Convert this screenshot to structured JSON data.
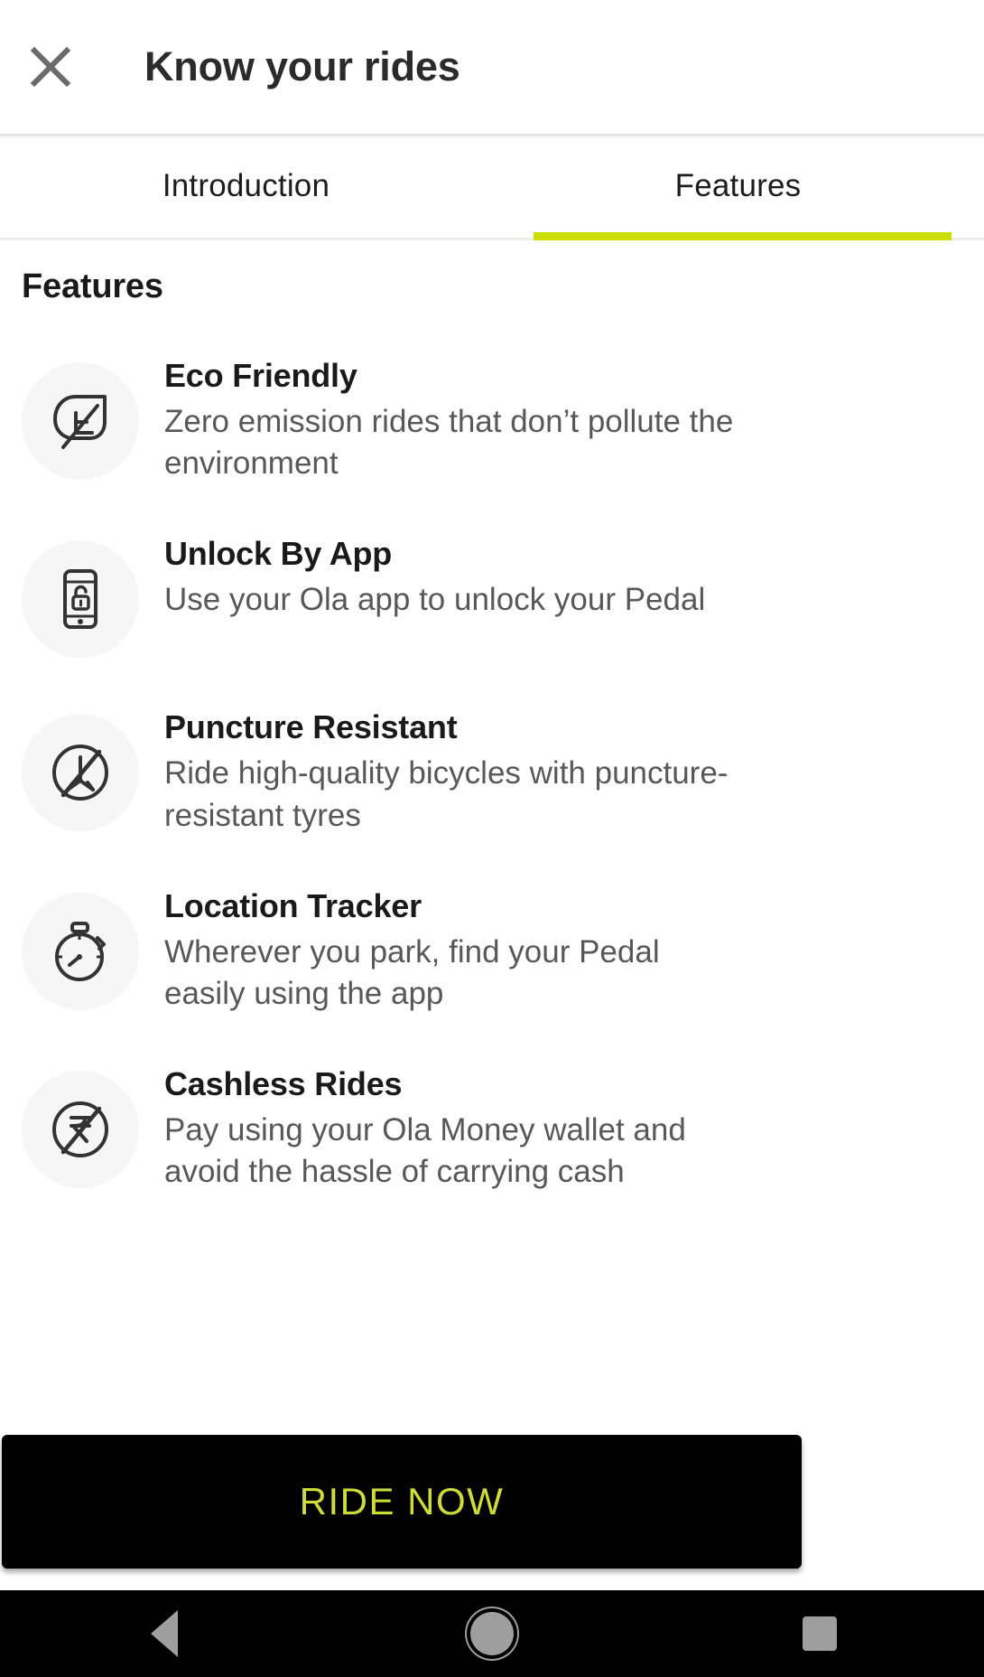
{
  "appbar": {
    "title": "Know your rides",
    "close_icon": "close-icon"
  },
  "tabs": [
    {
      "label": "Introduction",
      "active": false
    },
    {
      "label": "Features",
      "active": true
    }
  ],
  "content": {
    "section_title": "Features",
    "features": [
      {
        "icon": "leaf-icon",
        "title": "Eco Friendly",
        "description": "Zero emission rides that don’t pollute the environment"
      },
      {
        "icon": "phone-unlock-icon",
        "title": "Unlock By App",
        "description": "Use your Ola app to unlock your Pedal"
      },
      {
        "icon": "no-thorn-icon",
        "title": "Puncture Resistant",
        "description": "Ride high-quality bicycles with puncture-resistant tyres"
      },
      {
        "icon": "stopwatch-icon",
        "title": "Location Tracker",
        "description": "Wherever you park, find your Pedal easily using the app"
      },
      {
        "icon": "no-rupee-icon",
        "title": "Cashless Rides",
        "description": "Pay using your Ola Money wallet and avoid the hassle of carrying cash"
      }
    ]
  },
  "cta": {
    "label": "RIDE NOW"
  },
  "navbar": {
    "back": "back-triangle-icon",
    "home": "home-circle-icon",
    "recents": "recents-square-icon"
  },
  "colors": {
    "accent": "#cddc00",
    "cta_text": "#cddc39",
    "cta_bg": "#000000",
    "icon_circle_bg": "#f6f6f6",
    "title_text": "#1a1a1a",
    "desc_text": "#585858"
  }
}
